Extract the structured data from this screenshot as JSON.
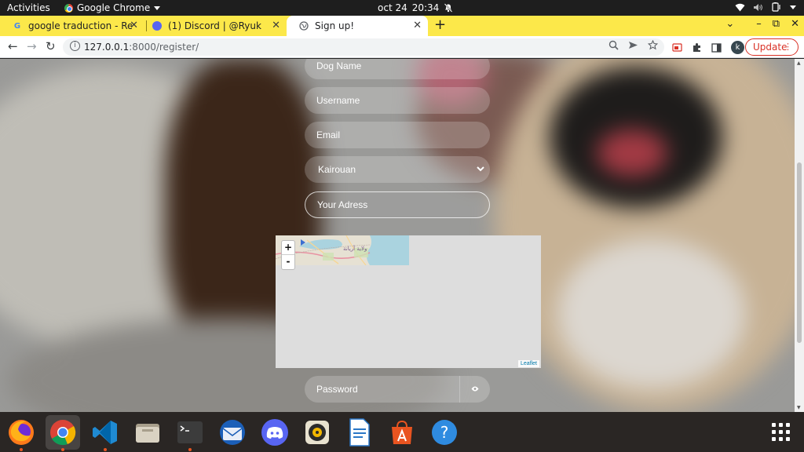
{
  "system_bar": {
    "activities": "Activities",
    "app_name": "Google Chrome",
    "date": "oct 24",
    "time": "20:34"
  },
  "tabs": [
    {
      "title": "google traduction - Reche",
      "favicon": "google-icon",
      "active": false
    },
    {
      "title": "(1) Discord | @Ryuk",
      "favicon": "discord-icon",
      "active": false
    },
    {
      "title": "Sign up!",
      "favicon": "globe-icon",
      "active": true
    }
  ],
  "toolbar": {
    "url_host": "127.0.0.1",
    "url_path": ":8000/register/",
    "profile_initial": "k",
    "update_label": "Update"
  },
  "form": {
    "dog_name_placeholder": "Dog Name",
    "username_placeholder": "Username",
    "email_placeholder": "Email",
    "city_selected": "Kairouan",
    "address_placeholder": "Your Adress",
    "password_placeholder": "Password"
  },
  "map": {
    "zoom_in": "+",
    "zoom_out": "-",
    "attribution": "Leaflet",
    "tile_label": "ولاية أريانة"
  },
  "dock": {
    "apps": [
      "firefox-icon",
      "chrome-icon",
      "vscode-icon",
      "files-icon",
      "terminal-icon",
      "thunderbird-icon",
      "discord-icon",
      "rhythmbox-icon",
      "writer-icon",
      "app-center-icon",
      "help-icon"
    ]
  },
  "colors": {
    "tabstrip": "#fce84a",
    "update_accent": "#d93025",
    "dock": "#2a2624"
  }
}
